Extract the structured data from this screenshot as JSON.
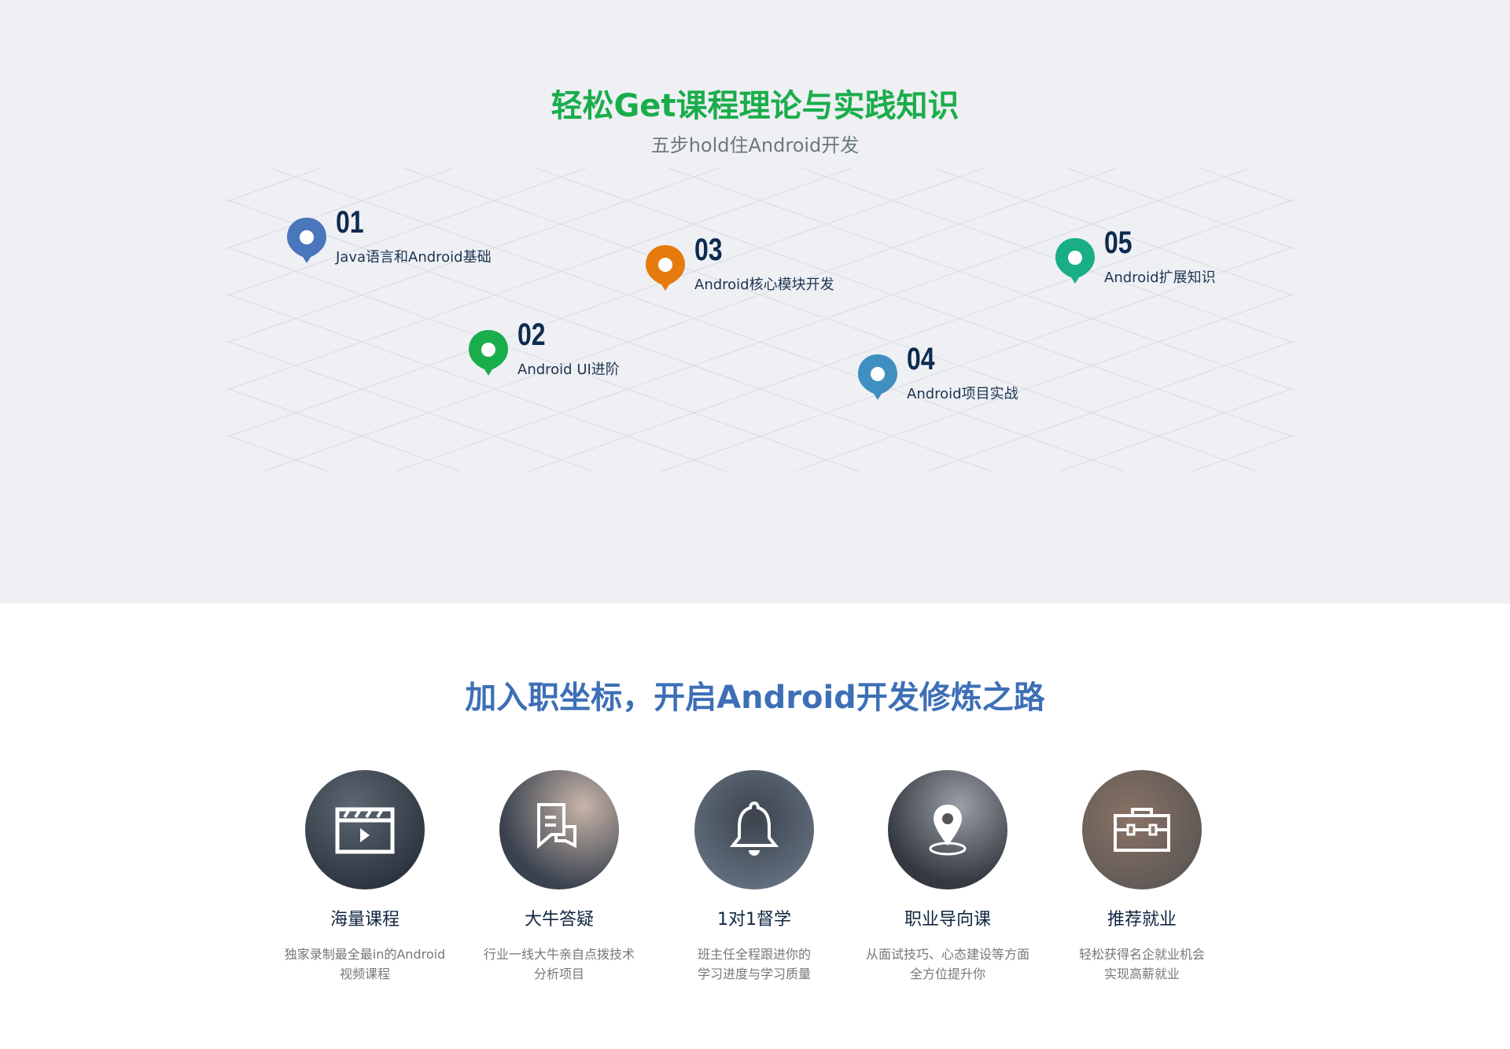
{
  "section1": {
    "title": "轻松Get课程理论与实践知识",
    "subtitle": "五步hold住Android开发",
    "steps": [
      {
        "num": "01",
        "label": "Java语言和Android基础",
        "color": "#4a76bb"
      },
      {
        "num": "02",
        "label": "Android UI进阶",
        "color": "#1aad4b"
      },
      {
        "num": "03",
        "label": "Android核心模块开发",
        "color": "#e67a0c"
      },
      {
        "num": "04",
        "label": "Android项目实战",
        "color": "#3f8fc0"
      },
      {
        "num": "05",
        "label": "Android扩展知识",
        "color": "#1aae86"
      }
    ]
  },
  "section2": {
    "title": "加入职坐标，开启Android开发修炼之路",
    "features": [
      {
        "icon": "video-clapper-icon",
        "title": "海量课程",
        "desc1": "独家录制最全最in的Android",
        "desc2": "视频课程"
      },
      {
        "icon": "chat-bubbles-icon",
        "title": "大牛答疑",
        "desc1": "行业一线大牛亲自点拨技术",
        "desc2": "分析项目"
      },
      {
        "icon": "bell-icon",
        "title": "1对1督学",
        "desc1": "班主任全程跟进你的",
        "desc2": "学习进度与学习质量"
      },
      {
        "icon": "location-pin-icon",
        "title": "职业导向课",
        "desc1": "从面试技巧、心态建设等方面",
        "desc2": "全方位提升你"
      },
      {
        "icon": "briefcase-icon",
        "title": "推荐就业",
        "desc1": "轻松获得名企就业机会",
        "desc2": "实现高薪就业"
      }
    ]
  }
}
